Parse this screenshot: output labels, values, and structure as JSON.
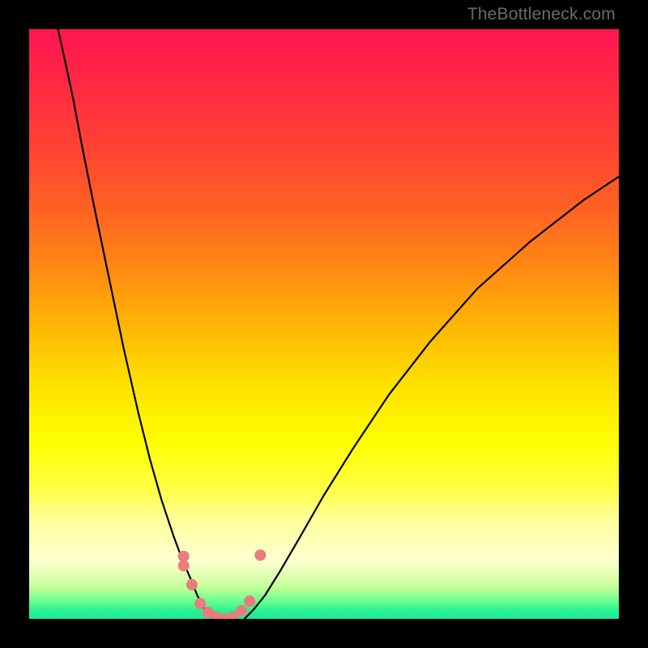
{
  "watermark": "TheBottleneck.com",
  "chart_data": {
    "type": "line",
    "title": "",
    "xlabel": "",
    "ylabel": "",
    "xlim": [
      0,
      100
    ],
    "ylim": [
      0,
      100
    ],
    "gradient_stops": [
      {
        "offset": 0.0,
        "color": "#ff1550"
      },
      {
        "offset": 0.1,
        "color": "#ff2b42"
      },
      {
        "offset": 0.2,
        "color": "#ff4232"
      },
      {
        "offset": 0.3,
        "color": "#ff6024"
      },
      {
        "offset": 0.4,
        "color": "#ff8714"
      },
      {
        "offset": 0.5,
        "color": "#ffb405"
      },
      {
        "offset": 0.6,
        "color": "#ffe000"
      },
      {
        "offset": 0.7,
        "color": "#ffff00"
      },
      {
        "offset": 0.78,
        "color": "#ffff45"
      },
      {
        "offset": 0.83,
        "color": "#ffff9a"
      },
      {
        "offset": 0.9,
        "color": "#ffffd0"
      },
      {
        "offset": 0.945,
        "color": "#c8ff9a"
      },
      {
        "offset": 0.97,
        "color": "#6aff90"
      },
      {
        "offset": 0.985,
        "color": "#2cf28e"
      },
      {
        "offset": 1.0,
        "color": "#1de9a4"
      }
    ],
    "series": [
      {
        "name": "curve-left",
        "type": "line",
        "x": [
          4.9,
          6.0,
          7.5,
          9.0,
          11.0,
          13.5,
          16.0,
          18.5,
          20.5,
          22.5,
          24.5,
          26.0,
          27.5,
          28.5,
          29.5,
          30.5,
          31.0
        ],
        "y": [
          100.0,
          95.0,
          88.0,
          80.0,
          70.0,
          58.0,
          46.0,
          35.0,
          27.0,
          20.0,
          14.0,
          10.0,
          6.5,
          4.0,
          2.0,
          0.7,
          0.0
        ]
      },
      {
        "name": "curve-right",
        "type": "line",
        "x": [
          36.5,
          38.0,
          40.0,
          42.5,
          46.0,
          50.0,
          55.0,
          61.0,
          68.0,
          76.0,
          85.0,
          94.0,
          100.0
        ],
        "y": [
          0.0,
          1.5,
          4.0,
          8.0,
          14.0,
          21.0,
          29.0,
          38.0,
          47.0,
          56.0,
          64.0,
          71.0,
          75.0
        ]
      }
    ],
    "markers": [
      {
        "x": 26.2,
        "y": 10.6,
        "r": 7,
        "fill": "#e97c7c"
      },
      {
        "x": 26.2,
        "y": 9.0,
        "r": 7,
        "fill": "#e97c7c"
      },
      {
        "x": 27.6,
        "y": 5.8,
        "r": 7,
        "fill": "#e97c7c"
      },
      {
        "x": 29.0,
        "y": 2.6,
        "r": 7,
        "fill": "#e97c7c"
      },
      {
        "x": 30.3,
        "y": 1.1,
        "r": 7,
        "fill": "#e97c7c"
      },
      {
        "x": 31.7,
        "y": 0.3,
        "r": 7,
        "fill": "#e97c7c"
      },
      {
        "x": 33.1,
        "y": 0.0,
        "r": 7,
        "fill": "#e97c7c"
      },
      {
        "x": 34.5,
        "y": 0.3,
        "r": 7,
        "fill": "#e97c7c"
      },
      {
        "x": 36.0,
        "y": 1.4,
        "r": 7,
        "fill": "#e97c7c"
      },
      {
        "x": 37.4,
        "y": 3.0,
        "r": 7,
        "fill": "#e97c7c"
      },
      {
        "x": 39.2,
        "y": 10.8,
        "r": 7,
        "fill": "#e97c7c"
      }
    ]
  }
}
